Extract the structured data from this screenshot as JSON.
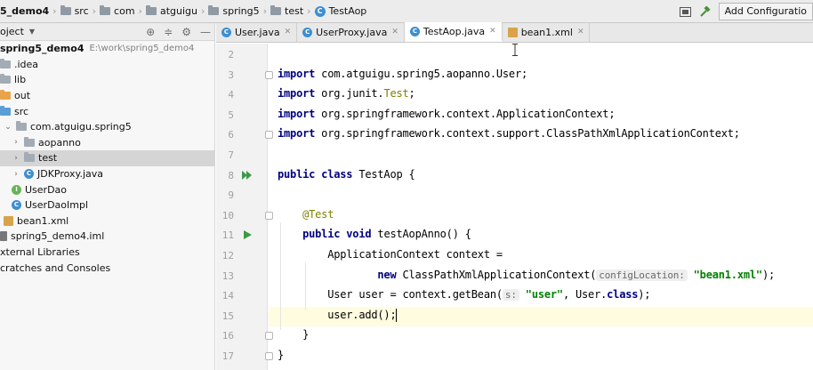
{
  "breadcrumb": {
    "project": "5_demo4",
    "items": [
      "src",
      "com",
      "atguigu",
      "spring5",
      "test"
    ],
    "file": "TestAop"
  },
  "toolbar": {
    "add_config_label": "Add Configuratio"
  },
  "project_panel": {
    "title": "oject",
    "tree": [
      {
        "label": "spring5_demo4",
        "hint": "E:\\work\\spring5_demo4",
        "bold": true,
        "depth": 0,
        "icon": "module-folder"
      },
      {
        "label": ".idea",
        "depth": 0,
        "icon": "folder-grey"
      },
      {
        "label": "lib",
        "depth": 0,
        "icon": "folder-grey"
      },
      {
        "label": "out",
        "depth": 0,
        "icon": "folder-orange"
      },
      {
        "label": "src",
        "depth": 0,
        "icon": "folder-blue"
      },
      {
        "label": "com.atguigu.spring5",
        "depth": 1,
        "icon": "package",
        "chevron": "open"
      },
      {
        "label": "aopanno",
        "depth": 2,
        "icon": "package",
        "chevron": "closed"
      },
      {
        "label": "test",
        "depth": 2,
        "icon": "package",
        "chevron": "closed",
        "selected": true
      },
      {
        "label": "JDKProxy.java",
        "depth": 2,
        "icon": "class-java",
        "chevron": "closed"
      },
      {
        "label": "UserDao",
        "depth": 2,
        "icon": "interface"
      },
      {
        "label": "UserDaoImpl",
        "depth": 2,
        "icon": "class"
      },
      {
        "label": "bean1.xml",
        "depth": 1,
        "icon": "xml"
      },
      {
        "label": "spring5_demo4.iml",
        "depth": 0,
        "icon": "iml"
      },
      {
        "label": "xternal Libraries",
        "depth": 0,
        "icon": "none"
      },
      {
        "label": "cratches and Consoles",
        "depth": 0,
        "icon": "none"
      }
    ]
  },
  "tabs": [
    {
      "label": "User.java",
      "icon": "class-icon",
      "active": false
    },
    {
      "label": "UserProxy.java",
      "icon": "class-icon",
      "active": false
    },
    {
      "label": "TestAop.java",
      "icon": "class-icon",
      "active": true
    },
    {
      "label": "bean1.xml",
      "icon": "xml-icon",
      "active": false
    }
  ],
  "editor": {
    "lines": [
      {
        "n": "2"
      },
      {
        "n": "3",
        "kw": "import",
        "rest": " com.atguigu.spring5.aopanno.User;"
      },
      {
        "n": "4",
        "kw": "import",
        "rest": " org.junit.",
        "ann": "Test",
        "tail": ";"
      },
      {
        "n": "5",
        "kw": "import",
        "rest": " org.springframework.context.ApplicationContext;"
      },
      {
        "n": "6",
        "kw": "import",
        "rest": " org.springframework.context.support.ClassPathXmlApplicationContext;"
      },
      {
        "n": "7"
      },
      {
        "n": "8",
        "kw": "public class",
        "rest": " TestAop {"
      },
      {
        "n": "9"
      },
      {
        "n": "10",
        "ann_line": "@Test"
      },
      {
        "n": "11",
        "kw": "public void",
        "rest": " testAopAnno() {"
      },
      {
        "n": "12",
        "text": "ApplicationContext context ="
      },
      {
        "n": "13",
        "kw": "new",
        "rest": " ClassPathXmlApplicationContext(",
        "hint": "configLocation:",
        "str": "\"bean1.xml\"",
        "tail": ");"
      },
      {
        "n": "14",
        "text": "User user = context.getBean(",
        "hint": "s:",
        "str": "\"user\"",
        "tail_a": ", User.",
        "kw2": "class",
        "tail": ");"
      },
      {
        "n": "15",
        "text": "user.add();"
      },
      {
        "n": "16",
        "text": "}"
      },
      {
        "n": "17",
        "text": "}"
      }
    ]
  }
}
